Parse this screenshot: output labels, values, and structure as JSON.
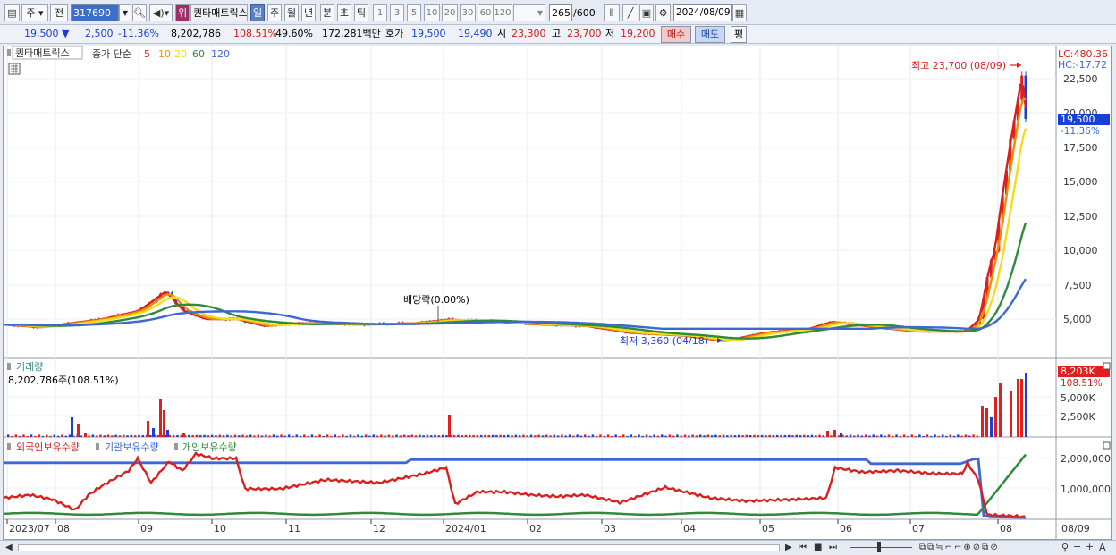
{
  "toolbar": {
    "market": "주",
    "prev_label": "전",
    "code": "317690",
    "warning_badge": "위",
    "stock_name": "퀀타매트릭스",
    "periods": [
      "일",
      "주",
      "월",
      "년",
      "분",
      "초",
      "틱"
    ],
    "active_period": "일",
    "intervals": [
      "1",
      "3",
      "5",
      "10",
      "20",
      "30",
      "60",
      "120"
    ],
    "count": "265",
    "count_total": "/600",
    "date": "2024/08/09"
  },
  "quote": {
    "price": "19,500",
    "change": "2,500",
    "change_pct": "-11.36%",
    "volume": "8,202,786",
    "volume_ratio": "108.51%",
    "rotation": "49.60%",
    "amount": "172,281백만",
    "ask_label": "호가",
    "ask": "19,500",
    "bid": "19,490",
    "open_label": "시",
    "open": "23,300",
    "high_label": "고",
    "high": "23,700",
    "low_label": "저",
    "low": "19,200",
    "buy_label": "매수",
    "sell_label": "매도",
    "eval_label": "평"
  },
  "price_panel": {
    "legend_name": "퀀타매트릭스",
    "ma_label": "종가 단순",
    "ma_periods": [
      "5",
      "10",
      "20",
      "60",
      "120"
    ],
    "ma_colors": [
      "#d72020",
      "#f08c00",
      "#f2dc1b",
      "#2e8b3a",
      "#3e67d4"
    ],
    "lc_label": "LC:480.36",
    "hc_label": "HC:-17.72",
    "high_annotation": "최고 23,700 (08/09)",
    "low_annotation": "최저 3,360 (04/18)",
    "dividend_annotation": "배당락(0.00%)",
    "current_price": "19,500",
    "current_pct": "-11.36%",
    "y_ticks": [
      "22,500",
      "20,000",
      "17,500",
      "15,000",
      "12,500",
      "10,000",
      "7,500",
      "5,000"
    ]
  },
  "volume_panel": {
    "title": "거래량",
    "value": "8,202,786주(108.51%)",
    "current": "8,203K",
    "current_pct": "108.51%",
    "y_ticks": [
      "5,000K",
      "2,500K"
    ]
  },
  "holdings_panel": {
    "legend": [
      "외국인보유수량",
      "기관보유수량",
      "개인보유수량"
    ],
    "colors": [
      "#d72020",
      "#3e67d4",
      "#2e8b3a"
    ],
    "y_ticks": [
      "2,000,000",
      "1,000,000"
    ]
  },
  "x_axis": [
    "2023/07",
    "08",
    "09",
    "10",
    "11",
    "12",
    "2024/01",
    "02",
    "03",
    "04",
    "05",
    "06",
    "07",
    "08"
  ],
  "x_axis_right": "08/09",
  "chart_data": {
    "type": "line",
    "x": [
      "2023/07",
      "2023/08",
      "2023/09",
      "2023/10",
      "2023/11",
      "2023/12",
      "2024/01",
      "2024/02",
      "2024/03",
      "2024/04",
      "2024/05",
      "2024/06",
      "2024/07",
      "2024/08/09"
    ],
    "series": [
      {
        "name": "종가",
        "values": [
          4500,
          4600,
          6800,
          4800,
          4600,
          4700,
          4900,
          4800,
          4500,
          3500,
          4200,
          4300,
          4000,
          19500
        ]
      }
    ],
    "ylim": [
      3000,
      24000
    ]
  }
}
